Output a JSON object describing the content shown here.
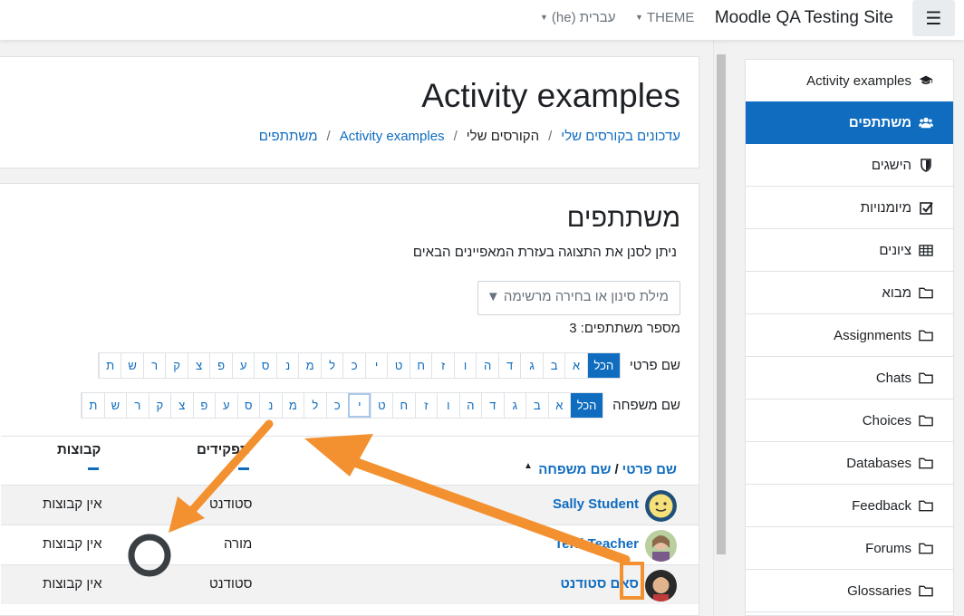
{
  "navbar": {
    "site_name": "Moodle QA Testing Site",
    "theme_label": "THEME",
    "language_label": "עברית (he)",
    "menu_icon": "hamburger-icon"
  },
  "header": {
    "title": "Activity examples",
    "breadcrumb": [
      "עדכונים בקורסים שלי",
      "הקורסים שלי",
      "Activity examples",
      "משתתפים"
    ]
  },
  "participants": {
    "title": "משתתפים",
    "filter_hint": "ניתן לסנן את התצוגה בעזרת המאפיינים הבאים",
    "filter_placeholder": "מילת סינון או בחירה מרשימה ▼",
    "count_text": "מספר משתתפים: 3",
    "first_name_label": "שם פרטי",
    "last_name_label": "שם משפחה",
    "all_label": "הכל",
    "first_initials": [
      "א",
      "ב",
      "ג",
      "ד",
      "ה",
      "ו",
      "ז",
      "ח",
      "ט",
      "י",
      "כ",
      "ל",
      "מ",
      "נ",
      "ס",
      "ע",
      "פ",
      "צ",
      "ק",
      "ר",
      "ש",
      "ת"
    ],
    "last_initials": [
      "א",
      "ב",
      "ג",
      "ד",
      "ה",
      "ו",
      "ז",
      "ח",
      "ט",
      "י",
      "כ",
      "ל",
      "מ",
      "נ",
      "ס",
      "ע",
      "פ",
      "צ",
      "ק",
      "ר",
      "ש",
      "ת"
    ],
    "columns": {
      "first_name": "שם פרטי",
      "last_name": "שם משפחה",
      "roles": "תפקידים",
      "groups": "קבוצות"
    },
    "rows": [
      {
        "name": "Sally Student",
        "role": "סטודנט",
        "groups": "אין קבוצות"
      },
      {
        "name": "Terri Teacher",
        "role": "מורה",
        "groups": "אין קבוצות"
      },
      {
        "name": "סאם סטודנט",
        "role": "סטודנט",
        "groups": "אין קבוצות"
      }
    ]
  },
  "drawer": {
    "items": [
      {
        "label": "Activity examples",
        "icon": "graduation-cap-icon"
      },
      {
        "label": "משתתפים",
        "icon": "users-icon",
        "active": true
      },
      {
        "label": "הישגים",
        "icon": "shield-icon"
      },
      {
        "label": "מיומנויות",
        "icon": "checkbox-icon"
      },
      {
        "label": "ציונים",
        "icon": "table-icon"
      },
      {
        "label": "מבוא",
        "icon": "folder-icon"
      },
      {
        "label": "Assignments",
        "icon": "folder-icon"
      },
      {
        "label": "Chats",
        "icon": "folder-icon"
      },
      {
        "label": "Choices",
        "icon": "folder-icon"
      },
      {
        "label": "Databases",
        "icon": "folder-icon"
      },
      {
        "label": "Feedback",
        "icon": "folder-icon"
      },
      {
        "label": "Forums",
        "icon": "folder-icon"
      },
      {
        "label": "Glossaries",
        "icon": "folder-icon"
      }
    ]
  },
  "colors": {
    "accent": "#0f6cbf",
    "annotation_orange": "#f39131",
    "annotation_ring": "#3a3f44"
  }
}
